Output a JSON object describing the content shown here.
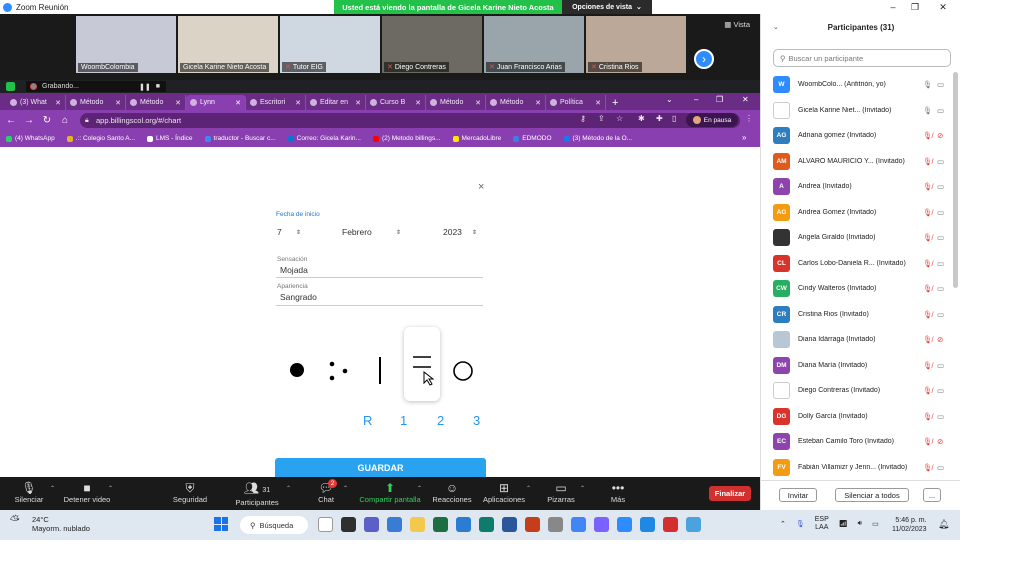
{
  "zoom": {
    "app_title": "Zoom Reunión",
    "share_message": "Usted está viendo la pantalla de Gicela Karine Nieto Acosta",
    "view_options": "Opciones de vista",
    "view_label": "Vista"
  },
  "video_tiles": [
    {
      "name": "WoombColombia",
      "muted": false,
      "bg": "#c7c9d6"
    },
    {
      "name": "Gicela Karine Nieto Acosta",
      "muted": false,
      "bg": "#dcd3c7"
    },
    {
      "name": "Tutor EIG",
      "muted": true,
      "bg": "#cfd8e0"
    },
    {
      "name": "Diego Contreras",
      "muted": true,
      "bg": "#6c6a63"
    },
    {
      "name": "Juan Francisco Arias",
      "muted": true,
      "bg": "#9aa5ab"
    },
    {
      "name": "Cristina Rios",
      "muted": true,
      "bg": "#bba898"
    }
  ],
  "recording": {
    "label": "Grabando...",
    "pause_icon": "pause-icon",
    "stop_icon": "stop-icon"
  },
  "browser": {
    "tabs": [
      {
        "label": "(3) What",
        "active": false
      },
      {
        "label": "Método",
        "active": false
      },
      {
        "label": "Método",
        "active": false
      },
      {
        "label": "Lynn",
        "active": true
      },
      {
        "label": "Escritori",
        "active": false
      },
      {
        "label": "Editar en",
        "active": false
      },
      {
        "label": "Curso B",
        "active": false
      },
      {
        "label": "Método",
        "active": false
      },
      {
        "label": "Método",
        "active": false
      },
      {
        "label": "Política",
        "active": false
      }
    ],
    "url": "app.billingscol.org/#/chart",
    "pause_label": "En pausa",
    "bookmarks": [
      "(4) WhatsApp",
      ".:: Colegio Santo A...",
      "LMS - Índice",
      "traductor - Buscar c...",
      "Correo: Gicela Karin...",
      "(2) Metodo billings...",
      "MercadoLibre",
      "EDMODO",
      "(3) Método de la O..."
    ],
    "bookmarks_more": "»"
  },
  "form": {
    "close": "×",
    "date_label": "Fecha de inicio",
    "day": "7",
    "month": "Febrero",
    "year": "2023",
    "sensation_label": "Sensación",
    "sensation_value": "Mojada",
    "appearance_label": "Apariencia",
    "appearance_value": "Sangrado",
    "rating_labels": [
      "R",
      "1",
      "2",
      "3"
    ],
    "save_label": "GUARDAR"
  },
  "toolbar": {
    "mute": "Silenciar",
    "stop_video": "Detener video",
    "security": "Seguridad",
    "participants": "Participantes",
    "participants_count": "31",
    "chat": "Chat",
    "chat_badge": "2",
    "share": "Compartir pantalla",
    "reactions": "Reacciones",
    "apps": "Aplicaciones",
    "whiteboards": "Pizarras",
    "more": "Más",
    "end": "Finalizar"
  },
  "participants_panel": {
    "title": "Participantes (31)",
    "search_placeholder": "Buscar un participante",
    "invite": "Invitar",
    "mute_all": "Silenciar a todos",
    "more": "...",
    "list": [
      {
        "initials": "W",
        "name": "WoombColo... (Anfitrión, yo)",
        "color": "#2d8cff",
        "mic_muted": false,
        "video_off": false
      },
      {
        "initials": "",
        "name": "Gicela Karine Niet... (Invitado)",
        "color": "#ffffff",
        "mic_muted": false,
        "video_off": false
      },
      {
        "initials": "AG",
        "name": "Adriana gomez (Invitado)",
        "color": "#2e7dbf",
        "mic_muted": true,
        "video_off": true
      },
      {
        "initials": "AM",
        "name": "ALVARO MAURICIO Y... (Invitado)",
        "color": "#e05a1e",
        "mic_muted": true,
        "video_off": false
      },
      {
        "initials": "A",
        "name": "Andrea (Invitado)",
        "color": "#8e44ad",
        "mic_muted": true,
        "video_off": false
      },
      {
        "initials": "AG",
        "name": "Andrea Gomez (Invitado)",
        "color": "#f39c12",
        "mic_muted": true,
        "video_off": false
      },
      {
        "initials": "",
        "name": "Angela Giraldo (Invitado)",
        "color": "#333333",
        "mic_muted": true,
        "video_off": false
      },
      {
        "initials": "CL",
        "name": "Carlos Lobo-Daniela R... (Invitado)",
        "color": "#d9342b",
        "mic_muted": true,
        "video_off": false
      },
      {
        "initials": "CW",
        "name": "Cindy Walteros (Invitado)",
        "color": "#27ae60",
        "mic_muted": true,
        "video_off": false
      },
      {
        "initials": "CR",
        "name": "Cristina Rios (Invitado)",
        "color": "#2e7dbf",
        "mic_muted": true,
        "video_off": false
      },
      {
        "initials": "",
        "name": "Diana Idárraga (Invitado)",
        "color": "#b7c7d6",
        "mic_muted": true,
        "video_off": true
      },
      {
        "initials": "DM",
        "name": "Diana Marìa (Invitado)",
        "color": "#8e44ad",
        "mic_muted": true,
        "video_off": false
      },
      {
        "initials": "",
        "name": "Diego Contreras (Invitado)",
        "color": "#ffffff",
        "mic_muted": true,
        "video_off": false
      },
      {
        "initials": "DG",
        "name": "Dolly García (Invitado)",
        "color": "#d9342b",
        "mic_muted": true,
        "video_off": false
      },
      {
        "initials": "EC",
        "name": "Esteban Camilo Toro (Invitado)",
        "color": "#8e44ad",
        "mic_muted": true,
        "video_off": true
      },
      {
        "initials": "FV",
        "name": "Fabián Villamizr y Jenn... (Invitado)",
        "color": "#f39c12",
        "mic_muted": true,
        "video_off": false
      }
    ]
  },
  "taskbar": {
    "temp": "24°C",
    "weather": "Mayorm. nublado",
    "search": "Búsqueda",
    "lang1": "ESP",
    "lang2": "LAA",
    "time": "5:46 p. m.",
    "date": "11/02/2023",
    "apps": [
      "#ffffff",
      "#2f2f2f",
      "#5b5fc7",
      "#3a7bd5",
      "#f2c94c",
      "#1d6f42",
      "#2b7cd3",
      "#0f7b6c",
      "#2b579a",
      "#c43e1c",
      "#888888",
      "#4285f4",
      "#7b61ff",
      "#2d8cff",
      "#1e88e5",
      "#d32f2f",
      "#4aa3df"
    ]
  }
}
